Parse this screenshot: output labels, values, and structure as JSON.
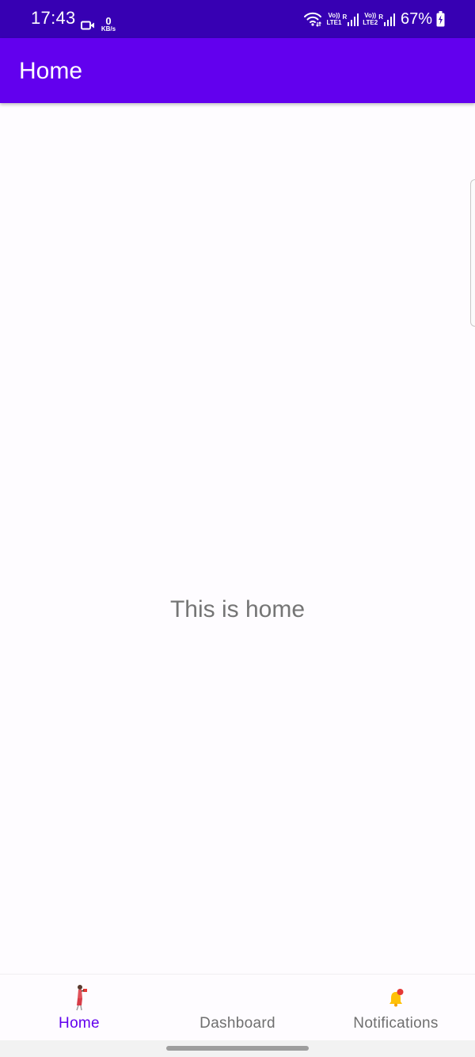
{
  "status_bar": {
    "time": "17:43",
    "net_speed_value": "0",
    "net_speed_unit": "KB/s",
    "sim1_volte": "Vo))",
    "sim1_type": "LTE1",
    "sim2_volte": "Vo))",
    "sim2_type": "LTE2",
    "roaming": "R",
    "battery_percent": "67%",
    "icons": [
      "video-camera-icon",
      "wifi-icon",
      "signal-icon",
      "battery-charging-icon"
    ]
  },
  "app_bar": {
    "title": "Home"
  },
  "main": {
    "message": "This is home"
  },
  "bottom_nav": {
    "items": [
      {
        "label": "Home",
        "icon": "home-figure-icon",
        "active": true
      },
      {
        "label": "Dashboard",
        "icon": "dashboard-icon",
        "active": false
      },
      {
        "label": "Notifications",
        "icon": "bell-icon",
        "active": false
      }
    ]
  },
  "colors": {
    "status_bar": "#3700b3",
    "app_bar": "#6200ee",
    "active_nav": "#6200ee",
    "inactive_nav": "#6f6f6f",
    "body_text": "#757575",
    "background": "#fefcff"
  }
}
